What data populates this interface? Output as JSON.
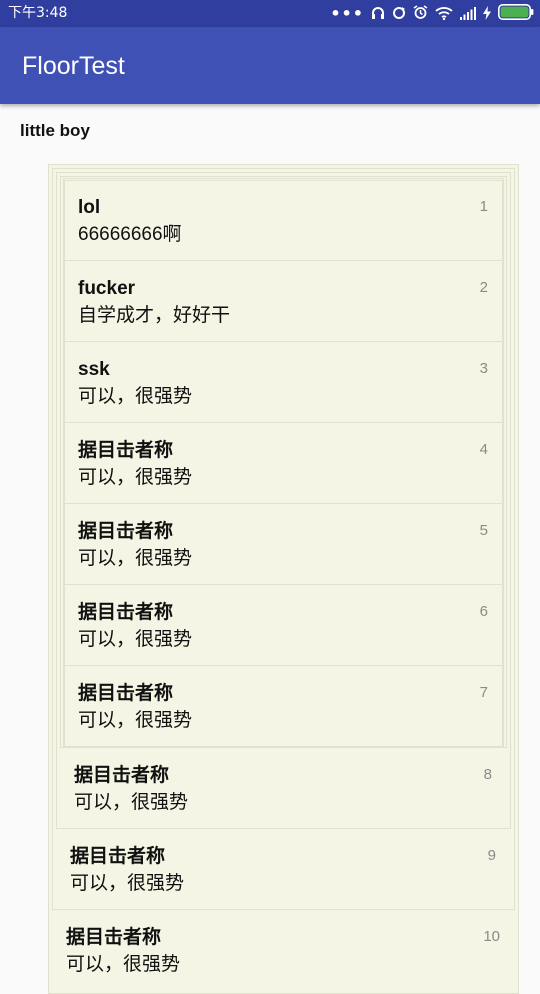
{
  "status_bar": {
    "time": "下午3:48",
    "icons": [
      "more-dots-icon",
      "headphones-icon",
      "sync-icon",
      "alarm-icon",
      "wifi-icon",
      "signal-icon",
      "charging-icon",
      "battery-icon"
    ],
    "battery_color": "#4caf50"
  },
  "app_bar": {
    "title": "FloorTest",
    "color": "#3f51b5",
    "status_color": "#303f9f"
  },
  "post": {
    "author": "little boy"
  },
  "floors": [
    {
      "name": "lol",
      "text": "66666666啊",
      "number": "1"
    },
    {
      "name": "fucker",
      "text": "自学成才，好好干",
      "number": "2"
    },
    {
      "name": "ssk",
      "text": "可以，很强势",
      "number": "3"
    },
    {
      "name": "据目击者称",
      "text": "可以，很强势",
      "number": "4"
    },
    {
      "name": "据目击者称",
      "text": "可以，很强势",
      "number": "5"
    },
    {
      "name": "据目击者称",
      "text": "可以，很强势",
      "number": "6"
    },
    {
      "name": "据目击者称",
      "text": "可以，很强势",
      "number": "7"
    },
    {
      "name": "据目击者称",
      "text": "可以，很强势",
      "number": "8"
    },
    {
      "name": "据目击者称",
      "text": "可以，很强势",
      "number": "9"
    },
    {
      "name": "据目击者称",
      "text": "可以，很强势",
      "number": "10"
    }
  ],
  "colors": {
    "floor_bg": "#f5f5e5",
    "floor_border": "#e1e1cf",
    "number_text": "#8a8a8a"
  }
}
